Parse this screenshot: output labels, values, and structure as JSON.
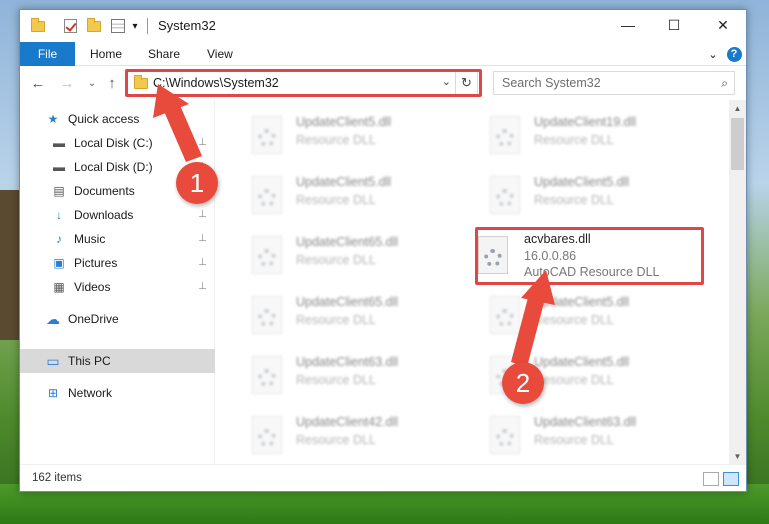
{
  "window": {
    "title": "System32",
    "minimize_glyph": "—",
    "maximize_glyph": "☐",
    "close_glyph": "✕"
  },
  "ribbon": {
    "tabs": [
      "File",
      "Home",
      "Share",
      "View"
    ],
    "expand_glyph": "⌄",
    "help_glyph": "?"
  },
  "address_bar": {
    "path": "C:\\Windows\\System32",
    "dropdown_glyph": "⌄",
    "refresh_glyph": "↻",
    "back_glyph": "←",
    "forward_glyph": "→",
    "recent_glyph": "⌄",
    "up_glyph": "↑"
  },
  "search": {
    "placeholder": "Search System32",
    "icon_glyph": "⌕"
  },
  "nav_pane": {
    "items": [
      {
        "label": "Quick access",
        "icon": "star-icon",
        "glyph": "★",
        "color": "#2b7cd3",
        "pinned": false
      },
      {
        "label": "Local Disk (C:)",
        "icon": "drive-icon",
        "glyph": "▬",
        "color": "#555555",
        "pinned": true
      },
      {
        "label": "Local Disk (D:)",
        "icon": "drive-icon",
        "glyph": "▬",
        "color": "#555555",
        "pinned": true
      },
      {
        "label": "Documents",
        "icon": "document-icon",
        "glyph": "▤",
        "color": "#555555",
        "pinned": true
      },
      {
        "label": "Downloads",
        "icon": "download-icon",
        "glyph": "↓",
        "color": "#2b7cd3",
        "pinned": true
      },
      {
        "label": "Music",
        "icon": "music-icon",
        "glyph": "♪",
        "color": "#2b7cd3",
        "pinned": true
      },
      {
        "label": "Pictures",
        "icon": "pictures-icon",
        "glyph": "▣",
        "color": "#2b7cd3",
        "pinned": true
      },
      {
        "label": "Videos",
        "icon": "videos-icon",
        "glyph": "▦",
        "color": "#555555",
        "pinned": true
      },
      {
        "label": "OneDrive",
        "icon": "cloud-icon",
        "glyph": "☁",
        "color": "#2b7cd3",
        "pinned": false
      },
      {
        "label": "This PC",
        "icon": "computer-icon",
        "glyph": "▭",
        "color": "#2b7cd3",
        "pinned": false,
        "selected": true
      },
      {
        "label": "Network",
        "icon": "network-icon",
        "glyph": "⊞",
        "color": "#2b7cd3",
        "pinned": false
      }
    ],
    "pin_glyph": "📌"
  },
  "files": {
    "left_column": [
      {
        "name": "UpdateClient5.dll",
        "type": "Resource DLL"
      },
      {
        "name": "UpdateClient5.dll",
        "type": "Resource DLL"
      },
      {
        "name": "UpdateClient65.dll",
        "type": "Resource DLL"
      },
      {
        "name": "UpdateClient65.dll",
        "type": "Resource DLL"
      },
      {
        "name": "UpdateClient63.dll",
        "type": "Resource DLL"
      },
      {
        "name": "UpdateClient42.dll",
        "type": "Resource DLL"
      }
    ],
    "right_column": [
      {
        "name": "UpdateClient19.dll",
        "type": "Resource DLL"
      },
      {
        "name": "UpdateClient5.dll",
        "type": "Resource DLL"
      },
      {
        "name": "UpdateClient5.dll",
        "type": "Resource DLL"
      },
      {
        "name": "UpdateClient5.dll",
        "type": "Resource DLL"
      },
      {
        "name": "UpdateClient63.dll",
        "type": "Resource DLL"
      }
    ],
    "highlighted": {
      "name": "acvbares.dll",
      "version": "16.0.0.86",
      "type": "AutoCAD Resource DLL"
    }
  },
  "status_bar": {
    "item_count": "162 items"
  },
  "annotations": {
    "step1": "1",
    "step2": "2",
    "color": "#e84a3c"
  }
}
